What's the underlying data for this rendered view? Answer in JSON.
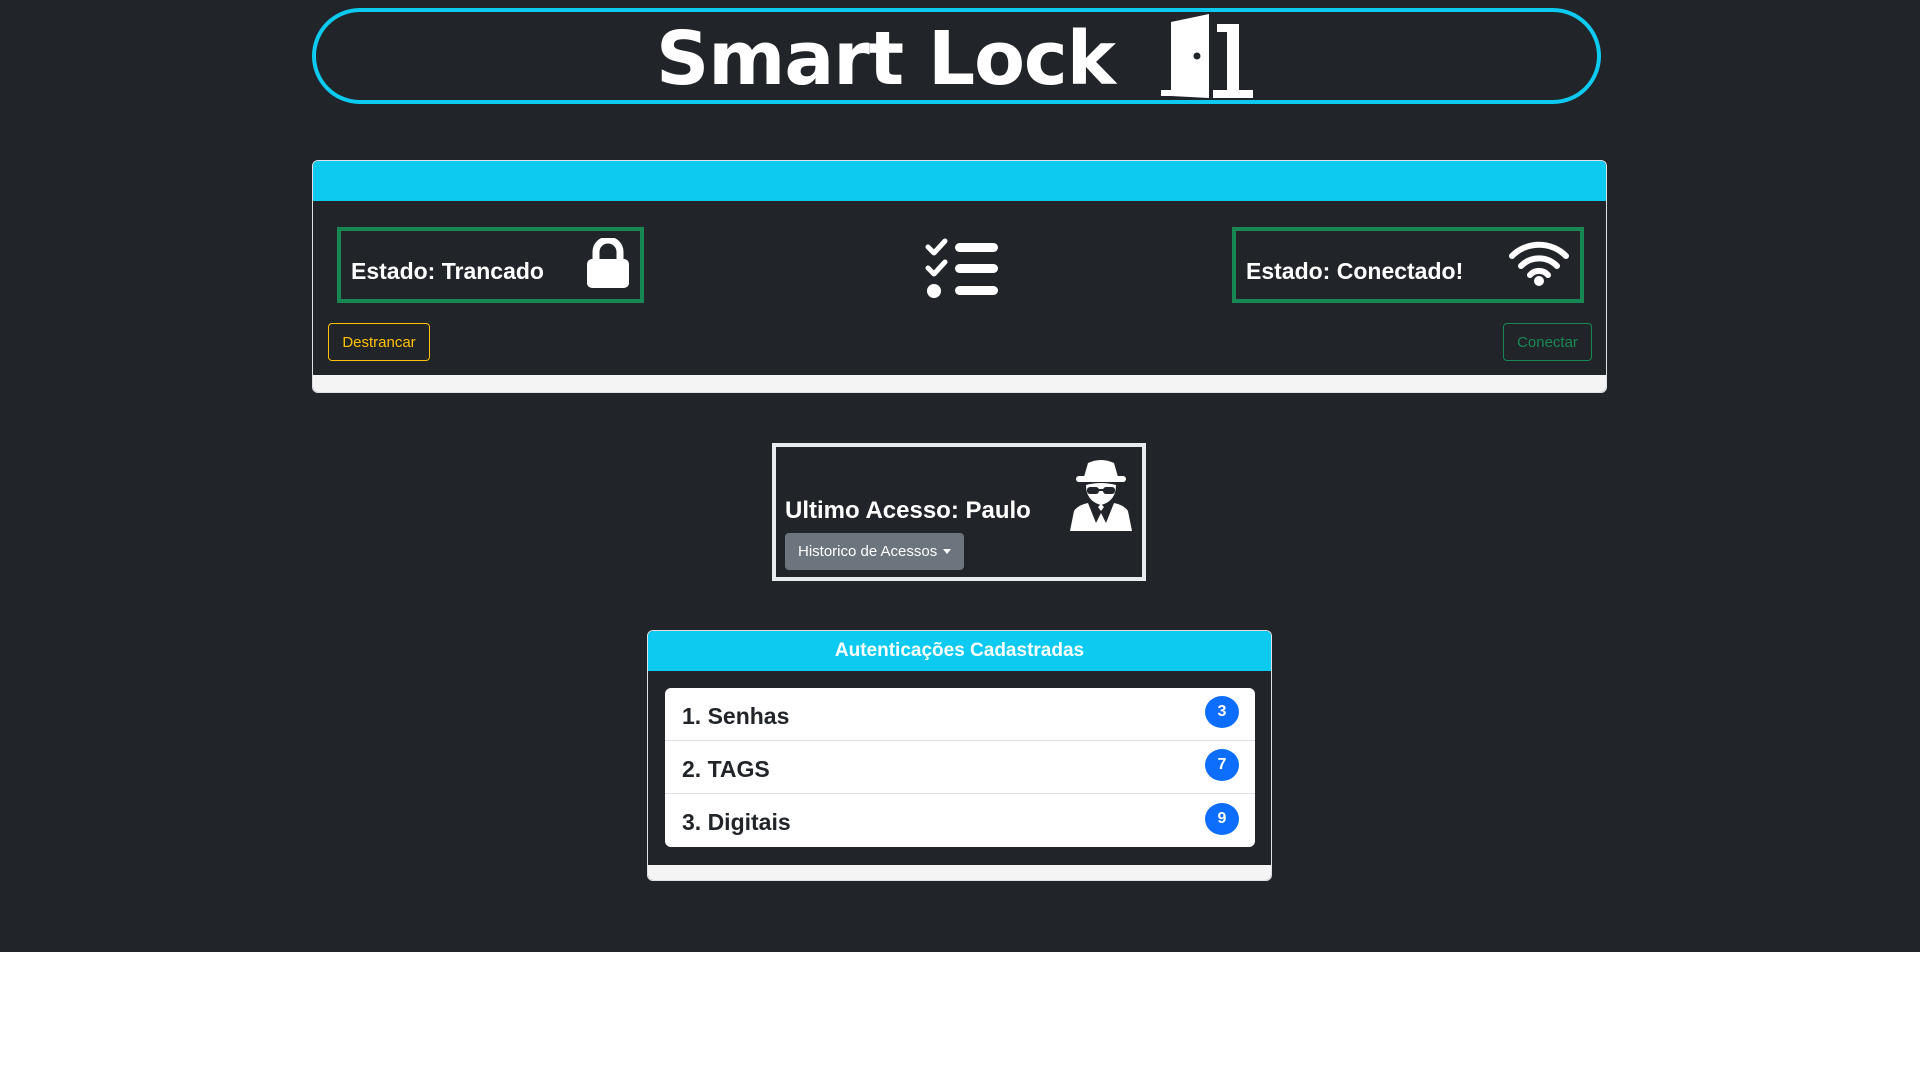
{
  "header": {
    "title": "Smart Lock",
    "icon": "door-open-icon"
  },
  "status": {
    "lock_state": "Estado: Trancado",
    "lock_icon": "lock-icon",
    "connection_state": "Estado: Conectado!",
    "connection_icon": "wifi-icon",
    "center_icon": "tasks-icon",
    "unlock_button": "Destrancar",
    "connect_button": "Conectar"
  },
  "access": {
    "last_access": "Ultimo Acesso: Paulo",
    "icon": "user-secret-icon",
    "history_button": "Historico de Acessos"
  },
  "auth": {
    "title": "Autenticações Cadastradas",
    "items": [
      {
        "label": "1. Senhas",
        "count": "3"
      },
      {
        "label": "2. TAGS",
        "count": "7"
      },
      {
        "label": "3. Digitais",
        "count": "9"
      }
    ]
  },
  "colors": {
    "background": "#212529",
    "accent": "#0dcaf0",
    "success": "#198754",
    "warning": "#ffc107",
    "badge": "#0d6efd",
    "secondary": "#6c757d"
  }
}
